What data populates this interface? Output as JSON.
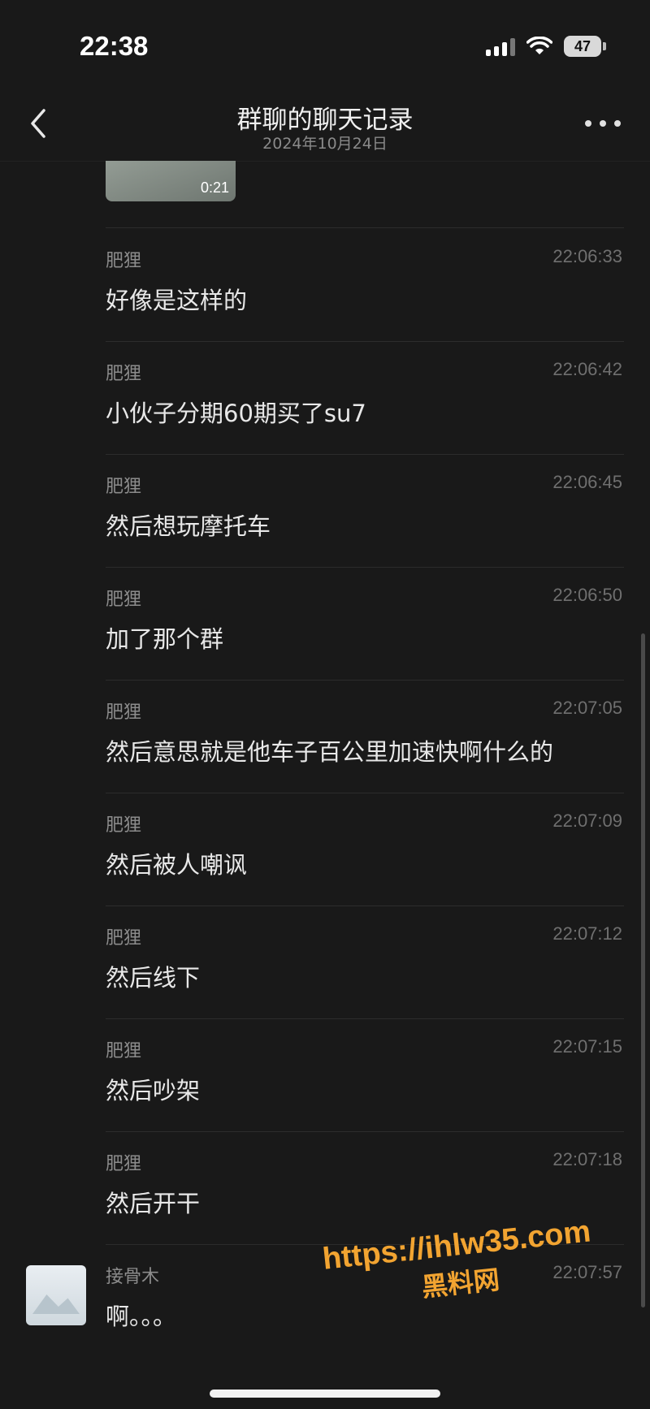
{
  "status": {
    "time": "22:38",
    "battery": "47"
  },
  "header": {
    "title": "群聊的聊天记录",
    "date": "2024年10月24日"
  },
  "video": {
    "duration": "0:21"
  },
  "messages": [
    {
      "name": "肥狸",
      "time": "22:06:33",
      "text": "好像是这样的"
    },
    {
      "name": "肥狸",
      "time": "22:06:42",
      "text": "小伙子分期60期买了su7"
    },
    {
      "name": "肥狸",
      "time": "22:06:45",
      "text": "然后想玩摩托车"
    },
    {
      "name": "肥狸",
      "time": "22:06:50",
      "text": "加了那个群"
    },
    {
      "name": "肥狸",
      "time": "22:07:05",
      "text": "然后意思就是他车子百公里加速快啊什么的"
    },
    {
      "name": "肥狸",
      "time": "22:07:09",
      "text": "然后被人嘲讽"
    },
    {
      "name": "肥狸",
      "time": "22:07:12",
      "text": "然后线下"
    },
    {
      "name": "肥狸",
      "time": "22:07:15",
      "text": "然后吵架"
    },
    {
      "name": "肥狸",
      "time": "22:07:18",
      "text": "然后开干"
    },
    {
      "name": "接骨木",
      "time": "22:07:57",
      "text": "啊。。。"
    }
  ],
  "watermark": {
    "url": "https://ihlw35.com",
    "name": "黑料网"
  },
  "icons": {
    "back": "chevron-left-icon",
    "more": "more-dots-icon",
    "signal": "cell-signal-icon",
    "wifi": "wifi-icon",
    "battery": "battery-icon"
  }
}
